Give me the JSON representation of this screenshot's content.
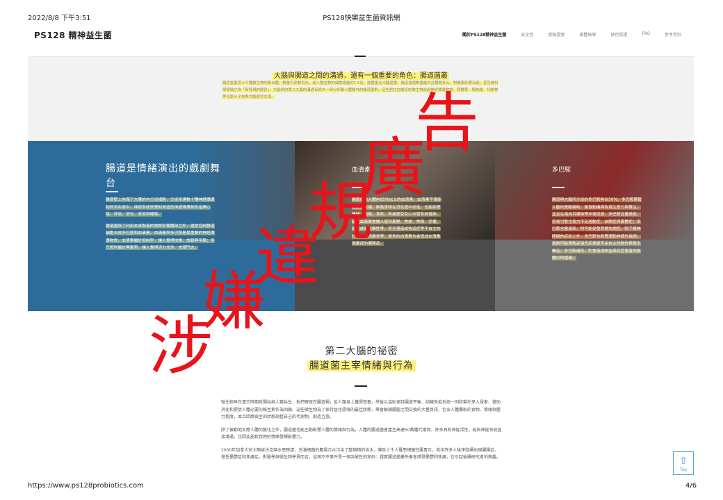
{
  "print_header": {
    "date": "2022/8/8 下午3:51",
    "title": "PS128快樂益生菌資訊網"
  },
  "nav": {
    "brand": "PS128 精神益生菌",
    "items": [
      {
        "label": "關於PS128精神益生菌",
        "active": true
      },
      {
        "label": "安全性",
        "active": false
      },
      {
        "label": "實驗證實",
        "active": false
      },
      {
        "label": "媒體報導",
        "active": false
      },
      {
        "label": "使用見證",
        "active": false
      },
      {
        "label": "FAQ",
        "active": false
      },
      {
        "label": "參考資料",
        "active": false
      }
    ]
  },
  "intro": {
    "heading": "大腦與腸道之間的溝通，還有一個重要的角色：腸道菌叢",
    "body": "腸道當菌受上千種微生物的集合體，數量可達數百兆，是人體全數的細胞總量的1.5倍，總重量比大腦還重。腸道當菌數量龐大且種類多元，對健康影響深遠，甚至被科學家稱之為「新發現的器官」。大腦與的第二大腦的溝通有很大一部分仰賴人體腸內的腸道菌群，這些居住在腸道的微生物透過神經傳導物質、荷爾蒙、胺肪酸、代謝物等化學分子來與大腦密切交流。"
  },
  "panels": [
    {
      "title": "腸道是情緒演出的戲劇舞台",
      "paragraphs": [
        "腸道壁上佈滿了大量的內分泌細胞，分泌多達數十種神經傳導物質到血液中。神經系統就是利用這些神經傳導物質指揮心跳、呼吸、消化、食欲與睡眠。",
        "腸道菌除了利用本身製造的物質影響腸部之外，還會控制腸道細胞合成多巴胺和血清素。血清素與多巴胺是最重要的神經傳導物質，血清素屬於抑制型，讓人覺得快樂、放鬆與平靜；多巴胺則屬於興奮型，讓人覺得活力充沛、充滿鬥志。"
      ]
    },
    {
      "title": "血清素",
      "paragraphs": [
        "腸道供給人體內95%以上的血清素。血清素不僅能讓腸道收縮，推動食物在消化道中前進，也能影響情緒、睡眠、食欲、疼痛感受及心血管系統健康。缺乏血清素會讓人感到憂鬱、焦慮、焦躁、恐懼、易怒或具攻擊性等，甚至還造成強迫症等不自主的行為，包括暴食等；過多的血清素也會造成血清素過量症的腸躁症。"
      ]
    },
    {
      "title": "多巴胺",
      "paragraphs": [
        "腸道與大腦所分泌的多巴胺各佔50%。多巴胺掌管人腦的獎勵機制，激發動機與負責注意力與專注，並且在達成目標後帶來愉悅感。多巴胺含量過低，容易引發注意力不足過動症、自閉症與憂鬱症；多巴胺含量過高，則可能促發思覺失調症。除了精神障礙的症狀之外，多巴胺也影響運動神經的協調，過剩可能導致妥瑞氏症患者不由自主的動作與發出聲音；多巴胺過低，則會造成帕金森氏症患者的肢體抖與僵硬。"
      ]
    }
  ],
  "section": {
    "title": "第二大腦的祕密",
    "subtitle": "腸道菌主宰情緒與行為"
  },
  "article": [
    "微生物早在遠古時期就開始與人類共生，他們寄居在腸道裡，從人類身上獲得營養，然後以協助保持腸道平衡、訓練免疫系統一同防禦外來入侵者、幫助消化和提供人體必要的維生素作為回饋。這些微生物為了保持居住環境的最佳狀態，學會解讀腸腦之間交換的大量資訊，包含人體攝取的食物、情緒與壓力程度，並且因應宿主的狀態調整自己的代謝物，創造互惠。",
    "除了被動地反應人體的變化之外，腸道菌也能主動影響人體的情緒與行為。人體的腸道菌會產生高達50萬種代謝物，許多具有神經活性，能與神經系統直接溝通，也因此能對我們的情緒發揮影響力。",
    "2000年加拿大安大略省沃克頓水患肆虐，充滿細菌的農場污水污染了整個鎮的供水，導致上千人罹患細菌性腸胃炎，其中許多人後來陸續出現腸躁症、慢性憂鬱症和焦慮症。對醫學與微生物學界而言，這個不幸事件是一個突破性的案例：證實腸道菌叢失衡會誘發憂鬱和焦慮，也引起後續研究者的興趣。"
  ],
  "top_button": {
    "label": "Top"
  },
  "stamp": {
    "text": "涉嫌違規廣告",
    "color": "#e8141b"
  },
  "print_footer": {
    "url": "https://www.ps128probiotics.com",
    "page": "4/6"
  }
}
